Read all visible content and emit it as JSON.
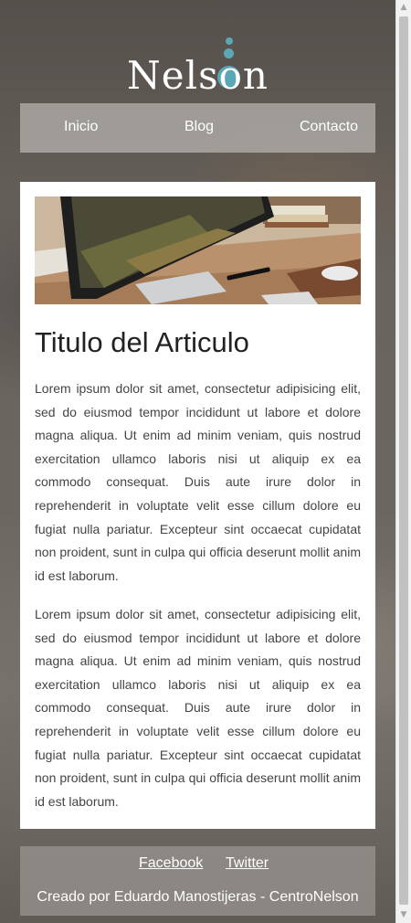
{
  "brand": {
    "logo_text": "Nelson",
    "accent_color": "#5aa8b6"
  },
  "nav": {
    "items": [
      {
        "label": "Inicio"
      },
      {
        "label": "Blog"
      },
      {
        "label": "Contacto"
      }
    ]
  },
  "article": {
    "image_alt": "Laptop on wooden desk",
    "title": "Titulo del Articulo",
    "paragraphs": [
      "Lorem ipsum dolor sit amet, consectetur adipisicing elit, sed do eiusmod tempor incididunt ut labore et dolore magna aliqua. Ut enim ad minim veniam, quis nostrud exercitation ullamco laboris nisi ut aliquip ex ea commodo consequat. Duis aute irure dolor in reprehenderit in voluptate velit esse cillum dolore eu fugiat nulla pariatur. Excepteur sint occaecat cupidatat non proident, sunt in culpa qui officia deserunt mollit anim id est laborum.",
      "Lorem ipsum dolor sit amet, consectetur adipisicing elit, sed do eiusmod tempor incididunt ut labore et dolore magna aliqua. Ut enim ad minim veniam, quis nostrud exercitation ullamco laboris nisi ut aliquip ex ea commodo consequat. Duis aute irure dolor in reprehenderit in voluptate velit esse cillum dolore eu fugiat nulla pariatur. Excepteur sint occaecat cupidatat non proident, sunt in culpa qui officia deserunt mollit anim id est laborum."
    ]
  },
  "footer": {
    "links": [
      {
        "label": "Facebook"
      },
      {
        "label": "Twitter"
      }
    ],
    "credit": "Creado por Eduardo Manostijeras - CentroNelson"
  }
}
